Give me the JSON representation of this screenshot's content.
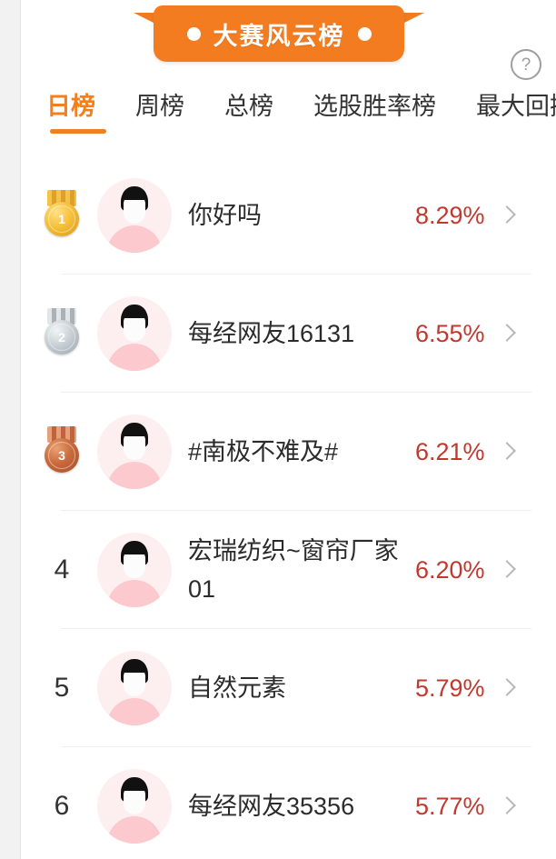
{
  "banner": {
    "title": "大赛风云榜",
    "left_dot": "dot",
    "right_dot": "dot",
    "color": "#f47c20"
  },
  "help": {
    "label": "?",
    "name": "help-icon"
  },
  "tabs": [
    {
      "label": "日榜",
      "active": true
    },
    {
      "label": "周榜",
      "active": false
    },
    {
      "label": "总榜",
      "active": false
    },
    {
      "label": "选股胜率榜",
      "active": false
    },
    {
      "label": "最大回撤榜",
      "active": false
    }
  ],
  "theme": {
    "accent": "#f2801e",
    "value_color": "#c0392f",
    "text_color": "#2b2b2b"
  },
  "rows": [
    {
      "rank": "1",
      "medal": "gold",
      "name": "你好吗",
      "value": "8.29%"
    },
    {
      "rank": "2",
      "medal": "silver",
      "name": "每经网友16131",
      "value": "6.55%"
    },
    {
      "rank": "3",
      "medal": "bronze",
      "name": "#南极不难及#",
      "value": "6.21%"
    },
    {
      "rank": "4",
      "medal": "none",
      "name": "宏瑞纺织~窗帘厂家01",
      "value": "6.20%"
    },
    {
      "rank": "5",
      "medal": "none",
      "name": "自然元素",
      "value": "5.79%"
    },
    {
      "rank": "6",
      "medal": "none",
      "name": "每经网友35356",
      "value": "5.77%"
    }
  ]
}
